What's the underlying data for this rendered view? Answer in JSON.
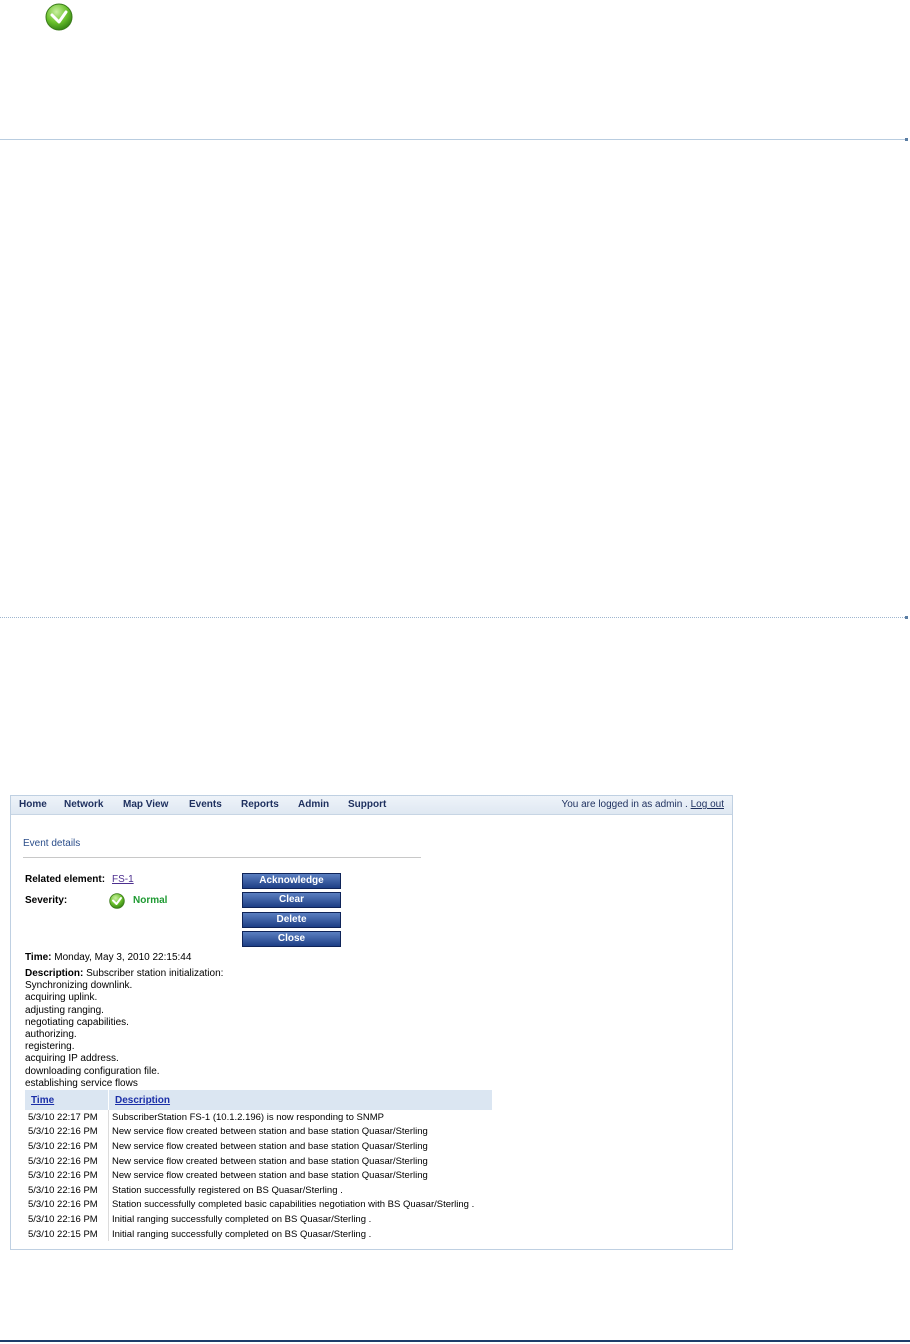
{
  "nav": {
    "items": [
      "Home",
      "Network",
      "Map View",
      "Events",
      "Reports",
      "Admin",
      "Support"
    ],
    "login_text": "You are logged in as admin .",
    "logout": "Log out"
  },
  "event": {
    "section_title": "Event details",
    "related_label": "Related element:",
    "related_value": "FS-1",
    "severity_label": "Severity:",
    "severity_value": "Normal",
    "buttons": [
      "Acknowledge",
      "Clear",
      "Delete",
      "Close"
    ],
    "time_label": "Time:",
    "time_value": "Monday, May 3, 2010 22:15:44",
    "description_label": "Description:",
    "description_lines": [
      "Subscriber station initialization:",
      "Synchronizing downlink.",
      "acquiring uplink.",
      "adjusting ranging.",
      "negotiating capabilities.",
      "authorizing.",
      "registering.",
      "acquiring IP address.",
      "downloading configuration file.",
      "establishing service flows"
    ]
  },
  "table": {
    "headers": [
      "Time",
      "Description"
    ],
    "rows": [
      [
        "5/3/10 22:17 PM",
        "SubscriberStation FS-1 (10.1.2.196) is now responding to SNMP"
      ],
      [
        "5/3/10 22:16 PM",
        "New service flow created between station and base station Quasar/Sterling"
      ],
      [
        "5/3/10 22:16 PM",
        "New service flow created between station and base station Quasar/Sterling"
      ],
      [
        "5/3/10 22:16 PM",
        "New service flow created between station and base station Quasar/Sterling"
      ],
      [
        "5/3/10 22:16 PM",
        "New service flow created between station and base station Quasar/Sterling"
      ],
      [
        "5/3/10 22:16 PM",
        "Station successfully registered on BS Quasar/Sterling ."
      ],
      [
        "5/3/10 22:16 PM",
        "Station successfully completed basic capabilities negotiation with BS Quasar/Sterling ."
      ],
      [
        "5/3/10 22:16 PM",
        "Initial ranging successfully completed on BS Quasar/Sterling ."
      ],
      [
        "5/3/10 22:15 PM",
        "Initial ranging successfully completed on BS Quasar/Sterling ."
      ]
    ]
  },
  "colors": {
    "status_normal": "#1e9a32",
    "button": "#2a4c93",
    "header_bg": "#dbe6f2"
  },
  "icons": {
    "top": "green-check-circle-icon",
    "severity": "green-check-circle-icon"
  }
}
